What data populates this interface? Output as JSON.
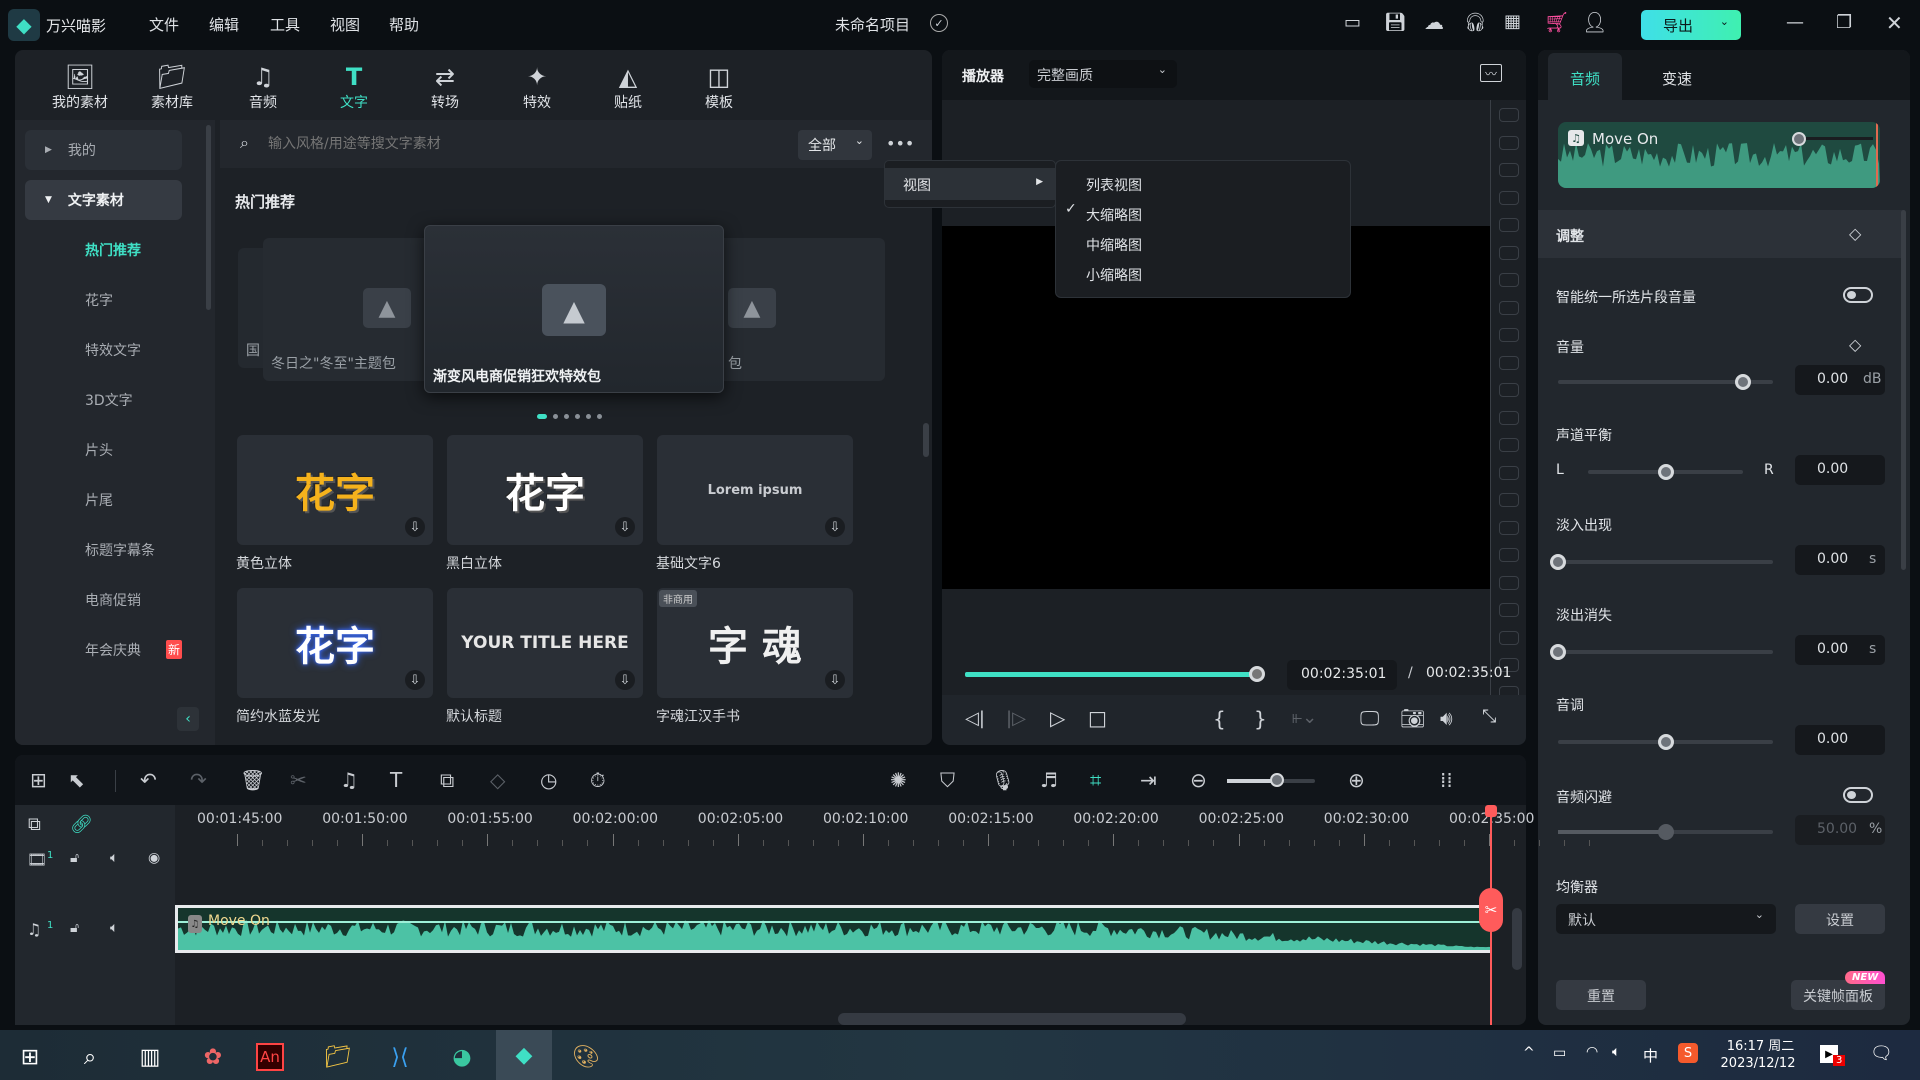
{
  "app": {
    "name": "万兴喵影",
    "project": "未命名项目",
    "export": "导出"
  },
  "menubar": [
    "文件",
    "编辑",
    "工具",
    "视图",
    "帮助"
  ],
  "toolbar": [
    {
      "label": "我的素材",
      "icon": "media-icon"
    },
    {
      "label": "素材库",
      "icon": "library-icon"
    },
    {
      "label": "音频",
      "icon": "music-icon"
    },
    {
      "label": "文字",
      "icon": "text-icon",
      "active": true
    },
    {
      "label": "转场",
      "icon": "transition-icon"
    },
    {
      "label": "特效",
      "icon": "effects-icon"
    },
    {
      "label": "贴纸",
      "icon": "sticker-icon"
    },
    {
      "label": "模板",
      "icon": "template-icon"
    }
  ],
  "sidebar": {
    "my": "我的",
    "group": "文字素材",
    "items": [
      "热门推荐",
      "花字",
      "特效文字",
      "3D文字",
      "片头",
      "片尾",
      "标题字幕条",
      "电商促销",
      "年会庆典"
    ],
    "new_badge": "新"
  },
  "search": {
    "placeholder": "输入风格/用途等搜文字素材",
    "filter": "全部"
  },
  "section_title": "热门推荐",
  "carousel": {
    "left": "冬日之\"冬至\"主题包",
    "left_edge": "国",
    "center": "渐变风电商促销狂欢特效包",
    "right": "包"
  },
  "grid": [
    {
      "label": "黄色立体",
      "preview": "花字",
      "color": "#f5b21c"
    },
    {
      "label": "黑白立体",
      "preview": "花字",
      "color": "#ffffff"
    },
    {
      "label": "基础文字6",
      "preview": "Lorem ipsum",
      "color": "#c9ccd1"
    },
    {
      "label": "简约水蓝发光",
      "preview": "花字",
      "color": "#ffffff"
    },
    {
      "label": "默认标题",
      "preview": "YOUR TITLE HERE",
      "color": "#e6e6e6"
    },
    {
      "label": "字魂江汉手书",
      "preview": "字 魂",
      "color": "#f0f0f0",
      "badge": "非商用"
    }
  ],
  "context_menu": {
    "item": "视图",
    "submenu": [
      "列表视图",
      "大缩略图",
      "中缩略图",
      "小缩略图"
    ],
    "checked": "大缩略图"
  },
  "player": {
    "title": "播放器",
    "quality": "完整画质",
    "current": "00:02:35:01",
    "total": "00:02:35:01",
    "progress": 1.0
  },
  "right": {
    "tabs": [
      "音频",
      "变速"
    ],
    "clip": "Move On",
    "section": "调整",
    "auto_normalize": "智能统一所选片段音量",
    "volume": {
      "label": "音量",
      "value": "0.00",
      "unit": "dB",
      "level": 0.86
    },
    "balance": {
      "label": "声道平衡",
      "l": "L",
      "r": "R",
      "value": "0.00",
      "level": 0.5
    },
    "fade_in": {
      "label": "淡入出现",
      "value": "0.00",
      "unit": "s",
      "level": 0
    },
    "fade_out": {
      "label": "淡出消失",
      "value": "0.00",
      "unit": "s",
      "level": 0
    },
    "pitch": {
      "label": "音调",
      "value": "0.00",
      "level": 0.5
    },
    "ducking": {
      "label": "音频闪避",
      "value": "50.00",
      "unit": "%",
      "level": 0.5
    },
    "eq": {
      "label": "均衡器",
      "value": "默认",
      "settings": "设置"
    },
    "reset": "重置",
    "keyframe": "关键帧面板",
    "new": "NEW"
  },
  "timeline": {
    "ticks": [
      "00:01:45:00",
      "00:01:50:00",
      "00:01:55:00",
      "00:02:00:00",
      "00:02:05:00",
      "00:02:10:00",
      "00:02:15:00",
      "00:02:20:00",
      "00:02:25:00",
      "00:02:30:00",
      "00:02:35:00"
    ],
    "clip": "Move On",
    "video_track": "1",
    "audio_track": "1"
  },
  "taskbar": {
    "time": "16:17 周二",
    "date": "2023/12/12",
    "ime": "中",
    "notif": "3"
  },
  "colors": {
    "accent": "#3fe0c5",
    "playhead": "#ff5b5b",
    "audio": "#4cc2a5"
  }
}
